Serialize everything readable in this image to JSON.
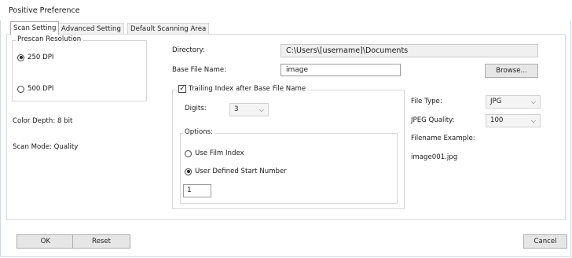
{
  "window": {
    "title": "Positive Preference"
  },
  "tabs": [
    {
      "label": "Scan Setting"
    },
    {
      "label": "Advanced Setting"
    },
    {
      "label": "Default Scanning Area"
    }
  ],
  "prescan": {
    "legend": "Prescan Resolution",
    "options": [
      {
        "label": "250 DPI",
        "selected": true
      },
      {
        "label": "500 DPI",
        "selected": false
      }
    ]
  },
  "left_info": {
    "color_depth": "Color Depth: 8 bit",
    "scan_mode": "Scan Mode: Quality"
  },
  "directory": {
    "label": "Directory:",
    "value": "C:\\Users\\[username]\\Documents"
  },
  "base_file_name": {
    "label": "Base File Name:",
    "value": "image"
  },
  "browse_label": "Browse...",
  "trailing_index": {
    "label": "Trailing Index after Base File Name",
    "checked": true,
    "digits_label": "Digits:",
    "digits_value": "3",
    "options_legend": "Options:",
    "options": [
      {
        "label": "Use Film Index",
        "selected": false
      },
      {
        "label": "User Defined Start Number",
        "selected": true
      }
    ],
    "start_number": "1"
  },
  "file_type": {
    "label": "File Type:",
    "value": "JPG"
  },
  "jpeg_quality": {
    "label": "JPEG Quality:",
    "value": "100"
  },
  "filename_example": {
    "label": "Filename Example:",
    "value": "image001.jpg"
  },
  "buttons": {
    "ok": "OK",
    "reset": "Reset",
    "cancel": "Cancel"
  },
  "icons": {
    "dropdown": "chevron-down-icon",
    "check": "check-icon"
  }
}
